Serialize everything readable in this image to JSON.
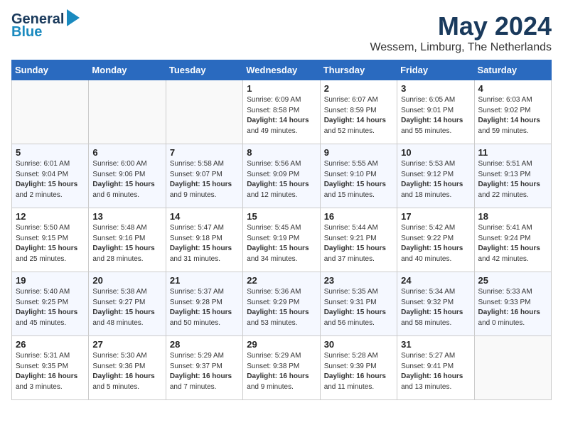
{
  "logo": {
    "line1": "General",
    "line2": "Blue",
    "arrow": true
  },
  "title": "May 2024",
  "location": "Wessem, Limburg, The Netherlands",
  "days_header": [
    "Sunday",
    "Monday",
    "Tuesday",
    "Wednesday",
    "Thursday",
    "Friday",
    "Saturday"
  ],
  "weeks": [
    [
      {
        "day": "",
        "info": ""
      },
      {
        "day": "",
        "info": ""
      },
      {
        "day": "",
        "info": ""
      },
      {
        "day": "1",
        "info": "Sunrise: 6:09 AM\nSunset: 8:58 PM\nDaylight: 14 hours\nand 49 minutes."
      },
      {
        "day": "2",
        "info": "Sunrise: 6:07 AM\nSunset: 8:59 PM\nDaylight: 14 hours\nand 52 minutes."
      },
      {
        "day": "3",
        "info": "Sunrise: 6:05 AM\nSunset: 9:01 PM\nDaylight: 14 hours\nand 55 minutes."
      },
      {
        "day": "4",
        "info": "Sunrise: 6:03 AM\nSunset: 9:02 PM\nDaylight: 14 hours\nand 59 minutes."
      }
    ],
    [
      {
        "day": "5",
        "info": "Sunrise: 6:01 AM\nSunset: 9:04 PM\nDaylight: 15 hours\nand 2 minutes."
      },
      {
        "day": "6",
        "info": "Sunrise: 6:00 AM\nSunset: 9:06 PM\nDaylight: 15 hours\nand 6 minutes."
      },
      {
        "day": "7",
        "info": "Sunrise: 5:58 AM\nSunset: 9:07 PM\nDaylight: 15 hours\nand 9 minutes."
      },
      {
        "day": "8",
        "info": "Sunrise: 5:56 AM\nSunset: 9:09 PM\nDaylight: 15 hours\nand 12 minutes."
      },
      {
        "day": "9",
        "info": "Sunrise: 5:55 AM\nSunset: 9:10 PM\nDaylight: 15 hours\nand 15 minutes."
      },
      {
        "day": "10",
        "info": "Sunrise: 5:53 AM\nSunset: 9:12 PM\nDaylight: 15 hours\nand 18 minutes."
      },
      {
        "day": "11",
        "info": "Sunrise: 5:51 AM\nSunset: 9:13 PM\nDaylight: 15 hours\nand 22 minutes."
      }
    ],
    [
      {
        "day": "12",
        "info": "Sunrise: 5:50 AM\nSunset: 9:15 PM\nDaylight: 15 hours\nand 25 minutes."
      },
      {
        "day": "13",
        "info": "Sunrise: 5:48 AM\nSunset: 9:16 PM\nDaylight: 15 hours\nand 28 minutes."
      },
      {
        "day": "14",
        "info": "Sunrise: 5:47 AM\nSunset: 9:18 PM\nDaylight: 15 hours\nand 31 minutes."
      },
      {
        "day": "15",
        "info": "Sunrise: 5:45 AM\nSunset: 9:19 PM\nDaylight: 15 hours\nand 34 minutes."
      },
      {
        "day": "16",
        "info": "Sunrise: 5:44 AM\nSunset: 9:21 PM\nDaylight: 15 hours\nand 37 minutes."
      },
      {
        "day": "17",
        "info": "Sunrise: 5:42 AM\nSunset: 9:22 PM\nDaylight: 15 hours\nand 40 minutes."
      },
      {
        "day": "18",
        "info": "Sunrise: 5:41 AM\nSunset: 9:24 PM\nDaylight: 15 hours\nand 42 minutes."
      }
    ],
    [
      {
        "day": "19",
        "info": "Sunrise: 5:40 AM\nSunset: 9:25 PM\nDaylight: 15 hours\nand 45 minutes."
      },
      {
        "day": "20",
        "info": "Sunrise: 5:38 AM\nSunset: 9:27 PM\nDaylight: 15 hours\nand 48 minutes."
      },
      {
        "day": "21",
        "info": "Sunrise: 5:37 AM\nSunset: 9:28 PM\nDaylight: 15 hours\nand 50 minutes."
      },
      {
        "day": "22",
        "info": "Sunrise: 5:36 AM\nSunset: 9:29 PM\nDaylight: 15 hours\nand 53 minutes."
      },
      {
        "day": "23",
        "info": "Sunrise: 5:35 AM\nSunset: 9:31 PM\nDaylight: 15 hours\nand 56 minutes."
      },
      {
        "day": "24",
        "info": "Sunrise: 5:34 AM\nSunset: 9:32 PM\nDaylight: 15 hours\nand 58 minutes."
      },
      {
        "day": "25",
        "info": "Sunrise: 5:33 AM\nSunset: 9:33 PM\nDaylight: 16 hours\nand 0 minutes."
      }
    ],
    [
      {
        "day": "26",
        "info": "Sunrise: 5:31 AM\nSunset: 9:35 PM\nDaylight: 16 hours\nand 3 minutes."
      },
      {
        "day": "27",
        "info": "Sunrise: 5:30 AM\nSunset: 9:36 PM\nDaylight: 16 hours\nand 5 minutes."
      },
      {
        "day": "28",
        "info": "Sunrise: 5:29 AM\nSunset: 9:37 PM\nDaylight: 16 hours\nand 7 minutes."
      },
      {
        "day": "29",
        "info": "Sunrise: 5:29 AM\nSunset: 9:38 PM\nDaylight: 16 hours\nand 9 minutes."
      },
      {
        "day": "30",
        "info": "Sunrise: 5:28 AM\nSunset: 9:39 PM\nDaylight: 16 hours\nand 11 minutes."
      },
      {
        "day": "31",
        "info": "Sunrise: 5:27 AM\nSunset: 9:41 PM\nDaylight: 16 hours\nand 13 minutes."
      },
      {
        "day": "",
        "info": ""
      }
    ]
  ]
}
